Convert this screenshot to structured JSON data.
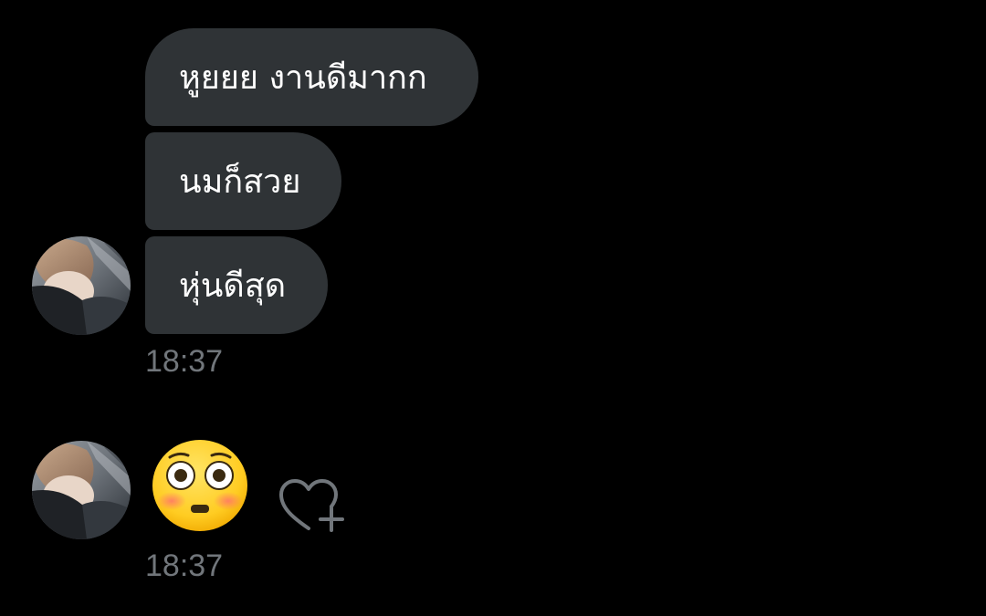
{
  "conversation": {
    "messages": [
      {
        "text": "หูยยย งานดีมากก"
      },
      {
        "text": "นมก็สวย"
      },
      {
        "text": "หุ่นดีสุด"
      }
    ],
    "group_timestamp": "18:37",
    "emoji_message": {
      "icon": "flushed-face-emoji",
      "timestamp": "18:37"
    },
    "reaction_button": {
      "icon": "heart-plus-icon"
    }
  },
  "colors": {
    "background": "#000000",
    "bubble": "#2f3336",
    "timestamp": "#71767b"
  }
}
